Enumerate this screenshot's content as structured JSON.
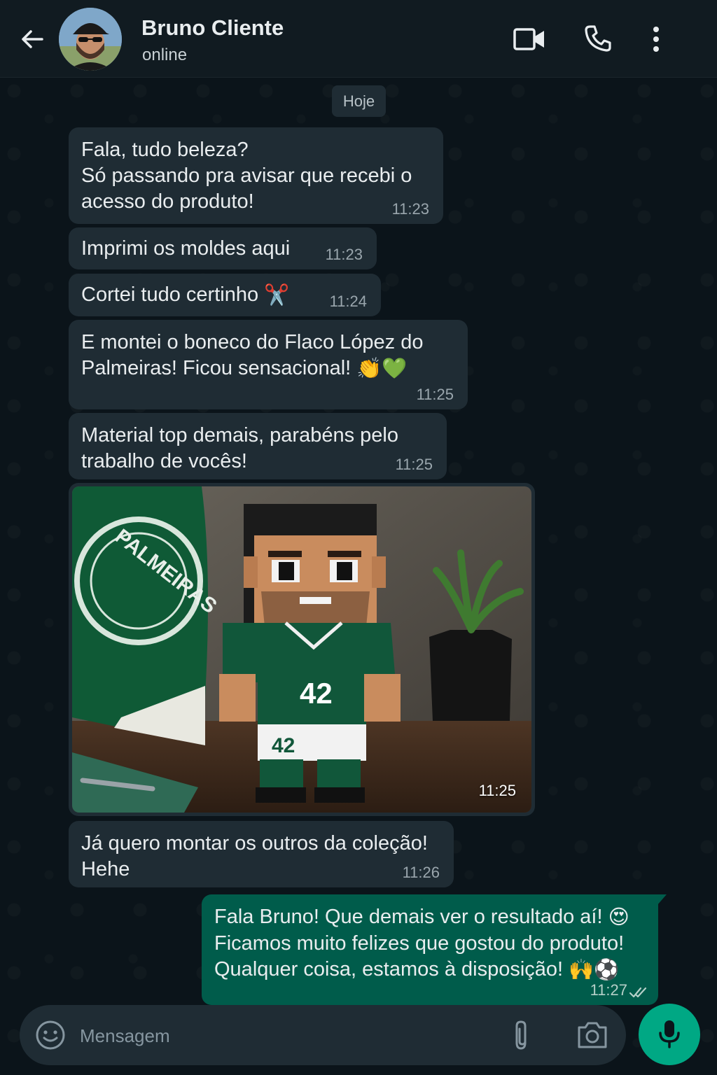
{
  "header": {
    "contact_name": "Bruno Cliente",
    "status": "online",
    "icons": [
      "back-arrow-icon",
      "video-call-icon",
      "phone-icon",
      "more-vert-icon"
    ]
  },
  "date_chip": "Hoje",
  "messages": [
    {
      "text": "Fala, tudo beleza?\nSó passando pra avisar que recebi o acesso do produto!",
      "time": "11:23"
    },
    {
      "text": "Imprimi os moldes aqui",
      "time": "11:23"
    },
    {
      "text": "Cortei tudo certinho",
      "time": "11:24",
      "emoji": "✂️"
    },
    {
      "text": "E montei o boneco do Flaco López do Palmeiras! Ficou sensacional!",
      "time": "11:25",
      "emoji": "👏💚"
    },
    {
      "text": "Material top demais, parabéns pelo trabalho de vocês!",
      "time": "11:25"
    },
    {
      "type": "image",
      "time": "11:25",
      "shirt_number": "42",
      "flag_text": "PALMEIRAS"
    },
    {
      "text": "Já quero montar os outros da coleção! Hehe",
      "time": "11:26"
    }
  ],
  "reply": {
    "line1": "Fala Bruno! Que demais ver o resultado aí!",
    "line1_emoji": "😍",
    "line2": "Ficamos muito felizes que gostou do produto!",
    "line3": "Qualquer coisa, estamos à disposição!",
    "line3_emoji": "🙌⚽",
    "time": "11:27",
    "status": "read"
  },
  "composer": {
    "placeholder": "Mensagem",
    "icons": [
      "emoji-icon",
      "attach-icon",
      "camera-icon",
      "mic-icon"
    ]
  },
  "colors": {
    "background": "#0b141a",
    "incoming_bubble": "#1f2c34",
    "outgoing_bubble": "#005c4b",
    "accent": "#00a884"
  }
}
